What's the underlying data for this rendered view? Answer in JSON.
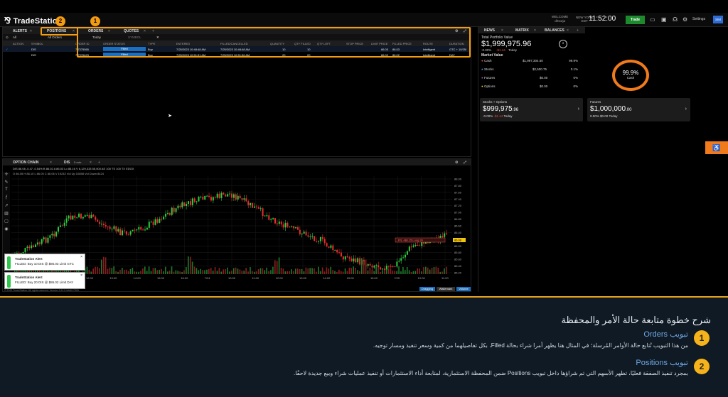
{
  "app": {
    "logo": "TradeStation",
    "welcome_label": "WELCOME",
    "welcome_user": "dlrsorja",
    "tz_label": "NEW YORK",
    "tz_sub": "EDT",
    "clock": "11:52:00",
    "trade_btn": "Trade",
    "settings": "Settings",
    "settings_badge": "SIM"
  },
  "orders_panel": {
    "tabs": [
      "ALERTS",
      "POSITIONS",
      "ORDERS",
      "QUOTES"
    ],
    "account": "All",
    "filter": "All Orders",
    "date": "Today",
    "symbol": "SYMBOL",
    "columns": [
      "ACTION",
      "SYMBOL",
      "ORDER ID",
      "ORDER STATUS",
      "TYPE",
      "ENTERED",
      "FILLED/CANCELLED",
      "QUANTITY",
      "QTY FILLED",
      "QTY LEFT",
      "STOP PRICE",
      "LIMIT PRICE",
      "FILLED PRICE",
      "ROUTE",
      "DURATION"
    ],
    "rows": [
      {
        "action": "",
        "symbol": "DIS",
        "order_id": "7.7375565",
        "status": "Filled",
        "type": "Buy",
        "entered": "7/25/2023 10:48:48 AM",
        "filled": "7/25/2023 10:48:48 AM",
        "qty": "10",
        "qty_filled": "10",
        "qty_left": "",
        "stop": "",
        "limit": "86.03",
        "fprice": "86.03",
        "route": "Intelligent",
        "duration": "GTC + 10/25/"
      },
      {
        "action": "",
        "symbol": "DIS",
        "order_id": "7.7376623",
        "status": "Filled",
        "type": "Buy",
        "entered": "7/25/2023 10:51:51 AM",
        "filled": "7/25/2023 10:51:56 AM",
        "qty": "20",
        "qty_filled": "20",
        "qty_left": "",
        "stop": "",
        "limit": "86.02",
        "fprice": "86.02",
        "route": "Intelligent",
        "duration": "DAY"
      }
    ]
  },
  "chart_panel": {
    "tabs": [
      "OPTION CHAIN",
      "DIS"
    ],
    "interval": "5 min",
    "ticker": "DIS",
    "header": "DIS  86.08  -0.47  -0.54%  B 86.02  A 86.03  Lo 85.16  V 6,129,333  55,000  AS 100  TS 100  TX EDGX",
    "ohlc": "O 86.05  H 86.10  L 86.05  C 86.06  V 19242  Vol Up 10858  Vol Down 8424",
    "y_ticks": [
      "88.00",
      "87.80",
      "87.60",
      "87.40",
      "87.20",
      "87.00",
      "86.80",
      "86.60",
      "86.40",
      "86.20",
      "86.00",
      "85.80",
      "85.60",
      "85.40",
      "85.20"
    ],
    "x_ticks": [
      "7/21",
      "10:00",
      "11:00",
      "12:00",
      "13:00",
      "14:00",
      "15:00",
      "16:00",
      "7/24",
      "10:00",
      "11:00",
      "12:00",
      "13:00",
      "14:00",
      "15:00",
      "16:00",
      "7/25",
      "10:00",
      "11:00"
    ],
    "order_label": "P/L +$0.15 Long 30",
    "last_price": "86.08",
    "buttons": [
      "Dragging",
      "Wallemark",
      "Volume"
    ],
    "footer": "© 2023 TradeStation. All rights reserved.   Version 1.91.0+db60.7325"
  },
  "alerts": [
    {
      "title": "TradeStation Alert",
      "text": "FILLED: Buy 10 DIS @ $86.03 Limit GTC"
    },
    {
      "title": "TradeStation Alert",
      "text": "FILLED: Buy 20 DIS @ $86.02 Limit DAY"
    }
  ],
  "right_panel": {
    "tabs": [
      "NEWS",
      "MATRIX",
      "BALANCES"
    ],
    "title": "Total Portfolio Value",
    "total": "$1,999,975.96",
    "change": "-0.00%",
    "change_amt": "-$1.44",
    "today": "Today",
    "market_value": "Market Value",
    "items": [
      {
        "name": "Cash",
        "value": "$1,997,304.50",
        "pct": "99.9%",
        "color": "#e74c3c"
      },
      {
        "name": "Stocks",
        "value": "$2,500.75",
        "pct": "0.1%",
        "color": "#3498db"
      },
      {
        "name": "Futures",
        "value": "$0.00",
        "pct": "0%",
        "color": "#9b59b6"
      },
      {
        "name": "Options",
        "value": "$0.00",
        "pct": "0%",
        "color": "#f1c40f"
      }
    ],
    "donut_pct": "99.9%",
    "donut_label": "Cash",
    "stocks_card": {
      "title": "Stocks + Options",
      "value": "$999,975",
      "cents": ".96",
      "change": "-0.00%",
      "amt": "-$1.44",
      "today": "Today"
    },
    "futures_card": {
      "title": "Futures",
      "value": "$1,000,000",
      "cents": ".00",
      "change": "0.00%",
      "amt": "$0.00",
      "today": "Today"
    }
  },
  "explain": {
    "heading": "شرح خطوة متابعة حالة الأمر والمحفظة",
    "items": [
      {
        "num": "1",
        "title": "تبويب Orders",
        "text": "من هذا التبويب تُتابع حالة الأوامر المُرسلة؛ في المثال هنا يظهر أمرا شراء بحالة Filled، بكل تفاصيلهما من كمية وسعر تنفيذ ومسار توجيه."
      },
      {
        "num": "2",
        "title": "تبويب Positions",
        "text": "بمجرد تنفيذ الصفقة فعليًا، تظهر الأسهم التي تم شراؤها داخل تبويب Positions ضمن المحفظة الاستثمارية، لمتابعة أداء الاستثمارات أو تنفيذ عمليات شراء وبيع جديدة لاحقًا."
      }
    ]
  },
  "annot_badges": [
    "1",
    "2"
  ],
  "chart_data": {
    "type": "candlestick",
    "ticker": "DIS"
  }
}
